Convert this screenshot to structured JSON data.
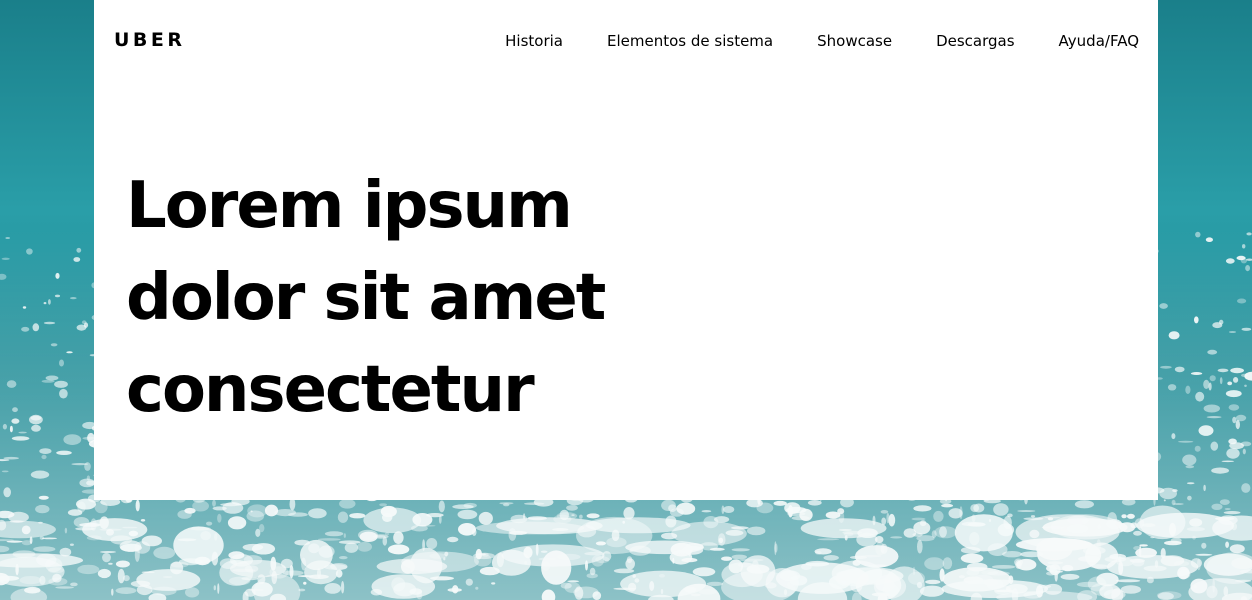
{
  "brand": {
    "logo_text": "UBER"
  },
  "nav": {
    "items": [
      {
        "label": "Historia"
      },
      {
        "label": "Elementos de sistema"
      },
      {
        "label": "Showcase"
      },
      {
        "label": "Descargas"
      },
      {
        "label": "Ayuda/FAQ"
      }
    ]
  },
  "hero": {
    "lines": [
      "Lorem ipsum",
      "dolor sit amet",
      "consectetur"
    ]
  },
  "colors": {
    "ocean_deep": "#1f8a94",
    "ocean_mid": "#2ba3ad",
    "foam": "#f4f8f8",
    "card": "#ffffff",
    "text": "#000000"
  },
  "background": {
    "image": "ocean-waves-photo"
  }
}
